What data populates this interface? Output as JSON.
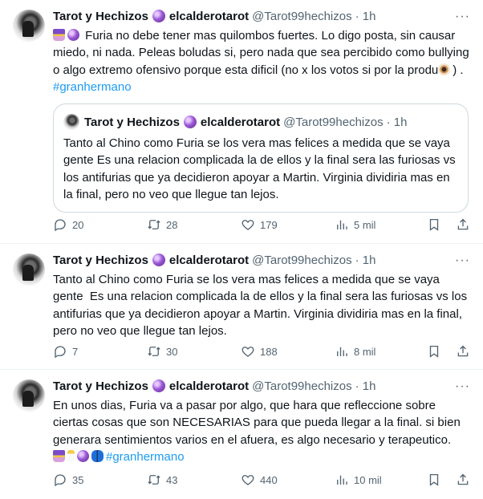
{
  "tweets": [
    {
      "name": "Tarot y Hechizos",
      "display2": "elcalderotarot",
      "handle": "@Tarot99hechizos",
      "time": "· 1h",
      "text_a": "Furia no debe tener mas quilombos fuertes. Lo digo posta, sin causar miedo, ni nada. Peleas boludas si, pero nada que sea percibido como bullying o algo extremo ofensivo porque esta dificil (no x los votos si por la produ",
      "text_b": ") . ",
      "hashtag": "#granhermano",
      "quote": {
        "name": "Tarot y Hechizos",
        "display2": "elcalderotarot",
        "handle": "@Tarot99hechizos",
        "time": "· 1h",
        "text": "Tanto al Chino como Furia se los vera mas felices a medida que se vaya gente  Es una relacion complicada la de ellos y la final sera las furiosas vs los antifurias que ya decidieron apoyar a Martin. Virginia dividiria mas en la final, pero no veo que llegue tan lejos."
      },
      "replies": "20",
      "reposts": "28",
      "likes": "179",
      "views": "5 mil"
    },
    {
      "name": "Tarot y Hechizos",
      "display2": "elcalderotarot",
      "handle": "@Tarot99hechizos",
      "time": "· 1h",
      "text": "Tanto al Chino como Furia se los vera mas felices a medida que se vaya gente  Es una relacion complicada la de ellos y la final sera las furiosas vs los antifurias que ya decidieron apoyar a Martin. Virginia dividiria mas en la final, pero no veo que llegue tan lejos.",
      "replies": "7",
      "reposts": "30",
      "likes": "188",
      "views": "8 mil"
    },
    {
      "name": "Tarot y Hechizos",
      "display2": "elcalderotarot",
      "handle": "@Tarot99hechizos",
      "time": "· 1h",
      "text": "En unos dias, Furia va a pasar por algo, que hara que refleccione sobre ciertas cosas que son NECESARIAS para que pueda llegar a la final. si bien generara sentimientos varios en el afuera, es algo necesario y terapeutico.",
      "hashtag": "#granhermano",
      "replies": "35",
      "reposts": "43",
      "likes": "440",
      "views": "10 mil"
    }
  ]
}
